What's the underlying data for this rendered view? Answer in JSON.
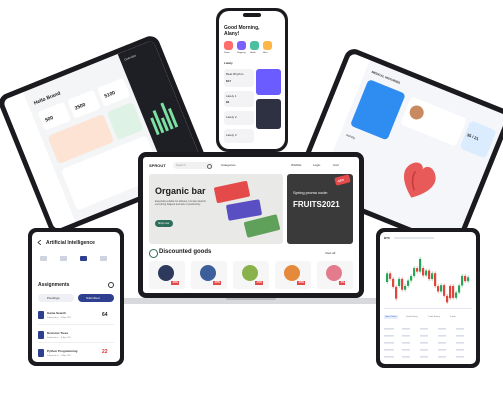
{
  "phone": {
    "greeting": "Good Morning,",
    "name": "Alany!",
    "section": "Lately",
    "categories": [
      "Phone",
      "Shopping",
      "Health",
      "More"
    ],
    "list": [
      {
        "title": "Beat Rhythm",
        "value": "$17"
      },
      {
        "title": "Lately 1",
        "value": "$4"
      },
      {
        "title": "Lately 2",
        "value": ""
      },
      {
        "title": "Lately 3",
        "value": ""
      }
    ]
  },
  "tablet_left": {
    "title": "Hello Brand",
    "stats": [
      "500",
      "2500",
      "5100"
    ],
    "chart_label": "Overview"
  },
  "tablet_right": {
    "title": "MEDICAL HISTORIES",
    "stat": "35 / 21",
    "section": "Activity"
  },
  "laptop": {
    "logo": "SPROUT",
    "search_placeholder": "Search",
    "categories_label": "Categories",
    "nav": [
      "Wishlist",
      "Login",
      "Cart"
    ],
    "hero_title": "Organic bar",
    "hero_text": "Especially suitable for athletes, but also ideal for everything fatigued and lack of productivity.",
    "hero_button": "Shop now",
    "promo_title": "Spring promo code:",
    "promo_code": "FRUITS2021",
    "discount_badge": "-15%",
    "section_title": "Discounted goods",
    "view_all": "View all",
    "products": [
      {
        "name": "Blackberry",
        "color": "#2d3a5c",
        "badge": "-10%"
      },
      {
        "name": "Blueberry",
        "color": "#3c5f9c",
        "badge": "-10%"
      },
      {
        "name": "Grapes",
        "color": "#8ab24a",
        "badge": "-15%"
      },
      {
        "name": "Apricot",
        "color": "#e58a3a",
        "badge": "-10%"
      },
      {
        "name": "Lychee",
        "color": "#e47b8c",
        "badge": "-5%"
      }
    ]
  },
  "tablet_small": {
    "title": "Artificial Intelligence",
    "section": "Assignments",
    "tabs": [
      "Pendings",
      "Submitted"
    ],
    "items": [
      {
        "title": "Game Search",
        "sub": "Submitted on : 16 Apr 2021",
        "score": "64",
        "score_color": "#222222"
      },
      {
        "title": "Decision Trees",
        "sub": "Submitted on : 11 Apr 2021",
        "score": "",
        "score_color": "#222222"
      },
      {
        "title": "Python Programming",
        "sub": "Submitted on : 14 Apr 2021",
        "score": "22",
        "score_color": "#e02c2c"
      }
    ]
  },
  "tablet_trading": {
    "pair": "BTC",
    "tabs": [
      "Open Orders",
      "Order History",
      "Trade History",
      "Funds"
    ]
  }
}
